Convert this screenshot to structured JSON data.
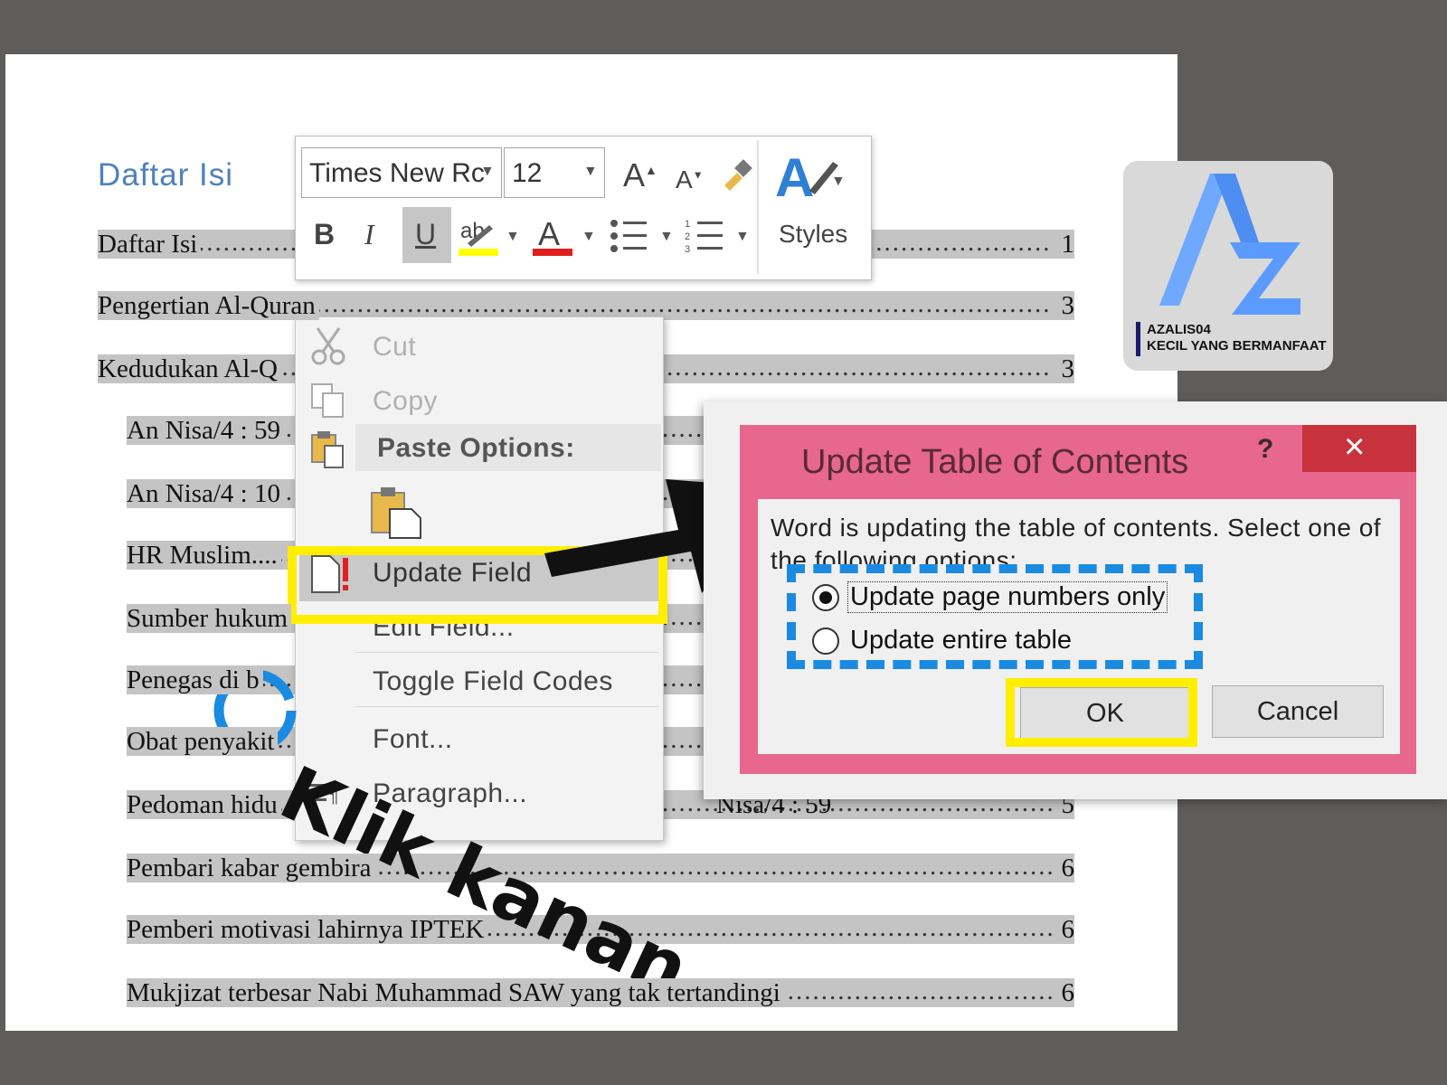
{
  "document": {
    "heading": "Daftar Isi",
    "toc_entries": [
      {
        "title": "Daftar Isi",
        "page": "1",
        "indent": 0
      },
      {
        "title": "Pengertian Al-Quran",
        "page": "3",
        "indent": 0
      },
      {
        "title": "Kedudukan Al-Q",
        "page": "3",
        "indent": 0
      },
      {
        "title": "An Nisa/4 : 59",
        "page": "",
        "indent": 1
      },
      {
        "title": "An Nisa/4 : 10",
        "page": "",
        "indent": 1
      },
      {
        "title": "HR Muslim....",
        "page": "",
        "indent": 1
      },
      {
        "title": "Sumber hukum",
        "page": "",
        "indent": 1
      },
      {
        "title": "Penegas di b",
        "page": "",
        "indent": 1
      },
      {
        "title": "Obat penyakit",
        "page": "",
        "indent": 1
      },
      {
        "title": "Pedoman hidu",
        "page": "5",
        "indent": 1
      },
      {
        "title": "Pembari kabar gembira",
        "page": "6",
        "indent": 1
      },
      {
        "title": "Pemberi motivasi lahirnya IPTEK",
        "page": "6",
        "indent": 1
      },
      {
        "title": "Mukjizat terbesar Nabi Muhammad SAW yang tak tertandingi",
        "page": "6",
        "indent": 1
      }
    ],
    "partial_behind_dialog": [
      "r Is",
      "rtia",
      "duk",
      "Nisa/4 : 59"
    ]
  },
  "toolbar": {
    "font_name": "Times New Rc",
    "font_size": "12",
    "grow_font": "A",
    "shrink_font": "A",
    "bold": "B",
    "italic": "I",
    "underline": "U",
    "highlight": "ab",
    "font_color": "A",
    "styles_label": "Styles",
    "styles_glyph": "A"
  },
  "context_menu": {
    "cut": "Cut",
    "copy": "Copy",
    "paste_options": "Paste Options:",
    "update_field": "Update Field",
    "edit_field": "Edit Field...",
    "toggle_field_codes": "Toggle Field Codes",
    "font": "Font...",
    "paragraph": "Paragraph..."
  },
  "dialog": {
    "title": "Update Table of Contents",
    "help": "?",
    "close": "×",
    "message": "Word is updating the table of contents.  Select one of the following options:",
    "option_page_numbers": "Update page numbers only",
    "option_entire_table": "Update entire table",
    "selected_option": "Update page numbers only",
    "ok": "OK",
    "cancel": "Cancel"
  },
  "annotation": {
    "instruction": "Klik kanan."
  },
  "logo": {
    "brand": "AZALIS04",
    "tagline": "KECIL YANG BERMANFAAT"
  },
  "colors": {
    "background": "#5f5c5c",
    "heading_blue": "#4f81bd",
    "field_gray": "#c4c4c4",
    "dialog_pink": "#e7678f",
    "highlight_yellow": "#ffee00",
    "highlight_blue": "#1a8be0"
  }
}
